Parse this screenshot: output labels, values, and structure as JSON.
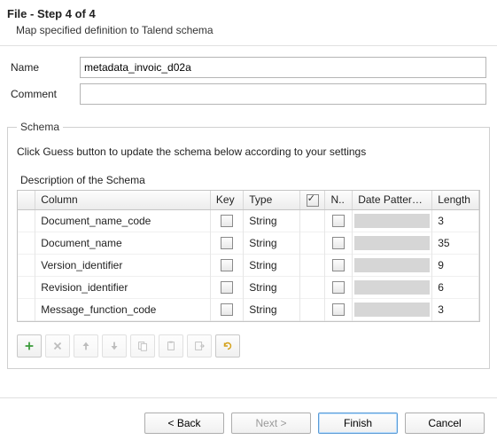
{
  "header": {
    "title": "File - Step 4 of 4",
    "subtitle": "Map specified definition to Talend schema"
  },
  "form": {
    "name_label": "Name",
    "name_value": "metadata_invoic_d02a",
    "comment_label": "Comment",
    "comment_value": ""
  },
  "schema": {
    "legend": "Schema",
    "hint": "Click Guess button to update the schema below according to your settings",
    "desc_label": "Description of the Schema",
    "columns": {
      "column": "Column",
      "key": "Key",
      "type": "Type",
      "n": "N..",
      "date": "Date Pattern...",
      "length": "Length"
    },
    "rows": [
      {
        "column": "Document_name_code",
        "key": false,
        "type": "String",
        "null": false,
        "date": "",
        "length": "3"
      },
      {
        "column": "Document_name",
        "key": false,
        "type": "String",
        "null": false,
        "date": "",
        "length": "35"
      },
      {
        "column": "Version_identifier",
        "key": false,
        "type": "String",
        "null": false,
        "date": "",
        "length": "9"
      },
      {
        "column": "Revision_identifier",
        "key": false,
        "type": "String",
        "null": false,
        "date": "",
        "length": "6"
      },
      {
        "column": "Message_function_code",
        "key": false,
        "type": "String",
        "null": false,
        "date": "",
        "length": "3"
      }
    ]
  },
  "toolbar": {
    "add": "add-row",
    "delete": "delete-row",
    "up": "move-up",
    "down": "move-down",
    "copy": "copy",
    "paste": "paste",
    "export": "export",
    "guess": "guess"
  },
  "footer": {
    "back": "< Back",
    "next": "Next >",
    "finish": "Finish",
    "cancel": "Cancel"
  }
}
